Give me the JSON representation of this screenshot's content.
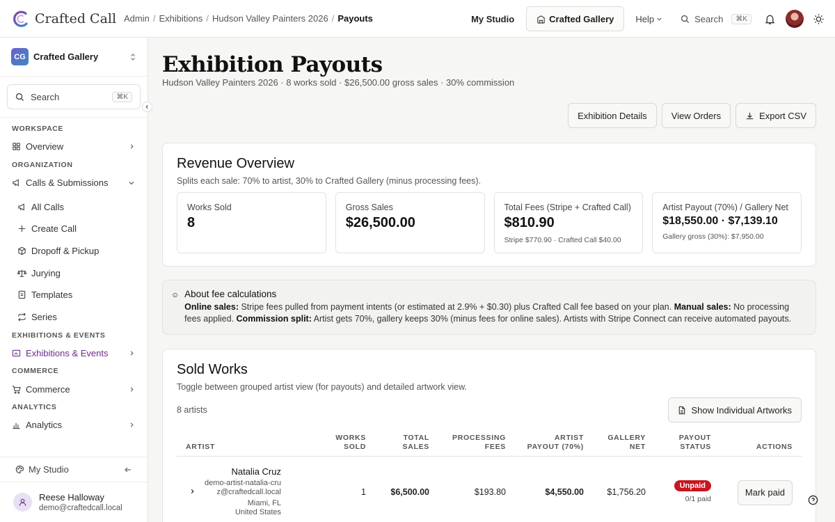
{
  "app": {
    "name": "Crafted Call"
  },
  "breadcrumb": [
    {
      "label": "Admin"
    },
    {
      "label": "Exhibitions"
    },
    {
      "label": "Hudson Valley Painters 2026"
    },
    {
      "label": "Payouts"
    }
  ],
  "topnav": {
    "my_studio": "My Studio",
    "gallery": "Crafted Gallery",
    "help": "Help",
    "search": "Search",
    "search_kbd": "⌘K"
  },
  "sidebar": {
    "org_initials": "CG",
    "org_name": "Crafted Gallery",
    "search": "Search",
    "search_kbd": "⌘K",
    "sections": {
      "workspace": "WORKSPACE",
      "organization": "ORGANIZATION",
      "exhibitions": "EXHIBITIONS & EVENTS",
      "commerce": "COMMERCE",
      "analytics": "ANALYTICS"
    },
    "items": {
      "overview": "Overview",
      "calls": "Calls & Submissions",
      "all_calls": "All Calls",
      "create_call": "Create Call",
      "dropoff": "Dropoff & Pickup",
      "jurying": "Jurying",
      "templates": "Templates",
      "series": "Series",
      "exhibitions": "Exhibitions & Events",
      "commerce": "Commerce",
      "analytics": "Analytics"
    },
    "my_studio": "My Studio",
    "user_name": "Reese Halloway",
    "user_email": "demo@craftedcall.local"
  },
  "page": {
    "title": "Exhibition Payouts",
    "subtitle": "Hudson Valley Painters 2026 · 8 works sold · $26,500.00 gross sales · 30% commission",
    "actions": {
      "details": "Exhibition Details",
      "orders": "View Orders",
      "export": "Export CSV"
    }
  },
  "revenue": {
    "title": "Revenue Overview",
    "subtitle": "Splits each sale: 70% to artist, 30% to Crafted Gallery (minus processing fees).",
    "stats": [
      {
        "label": "Works Sold",
        "value": "8",
        "note": ""
      },
      {
        "label": "Gross Sales",
        "value": "$26,500.00",
        "note": ""
      },
      {
        "label": "Total Fees (Stripe + Crafted Call)",
        "value": "$810.90",
        "note": "Stripe $770.90 · Crafted Call $40.00"
      },
      {
        "label": "Artist Payout (70%) / Gallery Net",
        "value": "$18,550.00 · $7,139.10",
        "note": "Gallery gross (30%): $7,950.00"
      }
    ]
  },
  "fee_info": {
    "title": "About fee calculations",
    "online_label": "Online sales:",
    "online_text": " Stripe fees pulled from payment intents (or estimated at 2.9% + $0.30) plus Crafted Call fee based on your plan. ",
    "manual_label": "Manual sales:",
    "manual_text": " No processing fees applied. ",
    "split_label": "Commission split:",
    "split_text": " Artist gets 70%, gallery keeps 30% (minus fees for online sales). Artists with Stripe Connect can receive automated payouts."
  },
  "sold": {
    "title": "Sold Works",
    "subtitle": "Toggle between grouped artist view (for payouts) and detailed artwork view.",
    "artist_count": "8 artists",
    "toggle_label": "Show Individual Artworks",
    "columns": [
      "ARTIST",
      "WORKS SOLD",
      "TOTAL SALES",
      "PROCESSING FEES",
      "ARTIST PAYOUT (70%)",
      "GALLERY NET",
      "PAYOUT STATUS",
      "ACTIONS"
    ],
    "rows": [
      {
        "name": "Natalia Cruz",
        "email": "demo-artist-natalia-cruz@craftedcall.local",
        "city": "Miami, FL",
        "country": "United States",
        "works": "1",
        "sales": "$6,500.00",
        "fees": "$193.80",
        "payout": "$4,550.00",
        "net": "$1,756.20",
        "status": "Unpaid",
        "status_note": "0/1 paid",
        "action": "Mark paid"
      }
    ]
  },
  "colors": {
    "accent": "#6b2d8a",
    "positive": "#237a2f",
    "unpaid": "#c8151f"
  }
}
